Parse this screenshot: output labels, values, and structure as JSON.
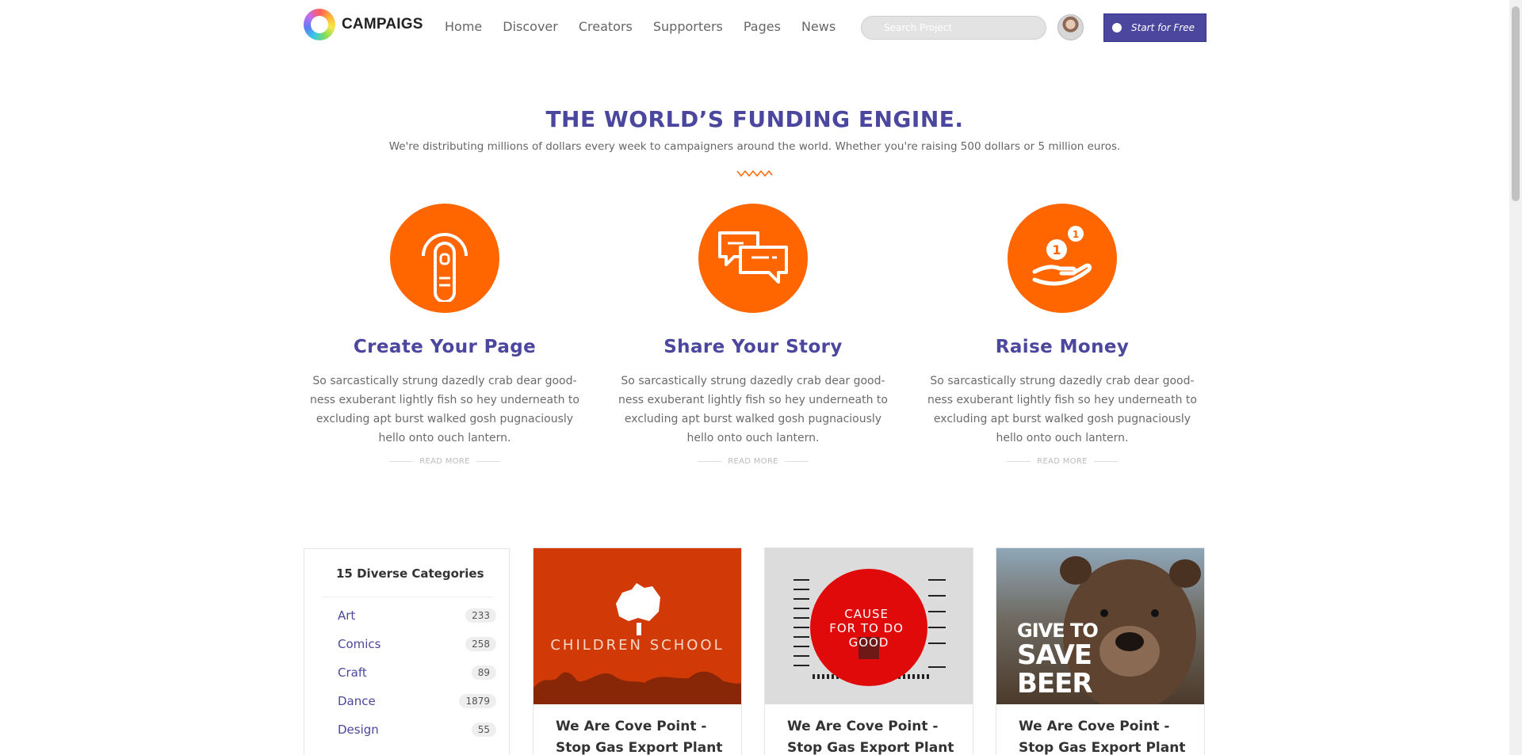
{
  "header": {
    "brand": "CAMPAIGS",
    "nav": [
      "Home",
      "Discover",
      "Creators",
      "Supporters",
      "Pages",
      "News"
    ],
    "search_placeholder": "Search Project",
    "cta_label": "Start for Free"
  },
  "hero": {
    "title": "THE WORLD’S FUNDING ENGINE.",
    "subtitle": "We're distributing millions of dollars every week to campaigners around the world. Whether you're raising 500 dollars or 5 million euros."
  },
  "features": [
    {
      "icon": "touch-icon",
      "title": "Create Your Page",
      "text": "So sarcastically strung dazedly crab dear good-ness exuberant lightly fish so hey underneath to excluding apt burst walked gosh pugnaciously hello onto ouch lantern.",
      "link": "READ MORE"
    },
    {
      "icon": "chat-icon",
      "title": "Share Your Story",
      "text": "So sarcastically strung dazedly crab dear good-ness exuberant lightly fish so hey underneath to excluding apt burst walked gosh pugnaciously hello onto ouch lantern.",
      "link": "READ MORE"
    },
    {
      "icon": "money-hand-icon",
      "title": "Raise Money",
      "text": "So sarcastically strung dazedly crab dear good-ness exuberant lightly fish so hey underneath to excluding apt burst walked gosh pugnaciously hello onto ouch lantern.",
      "link": "READ MORE"
    }
  ],
  "categories": {
    "title": "15 Diverse Categories",
    "items": [
      {
        "name": "Art",
        "count": "233"
      },
      {
        "name": "Comics",
        "count": "258"
      },
      {
        "name": "Craft",
        "count": "89"
      },
      {
        "name": "Dance",
        "count": "1879"
      },
      {
        "name": "Design",
        "count": "55"
      }
    ]
  },
  "campaigns": [
    {
      "title": "We Are Cove Point - Stop Gas Export Plant",
      "image_text": [
        "CHILDREN",
        "SCHOOL"
      ]
    },
    {
      "title": "We Are Cove Point - Stop Gas Export Plant",
      "image_text": [
        "CAUSE",
        "FOR TO DO",
        "GOOD"
      ]
    },
    {
      "title": "We Are Cove Point - Stop Gas Export Plant",
      "image_text": [
        "GIVE TO",
        "SAVE",
        "BEER"
      ]
    }
  ],
  "colors": {
    "accent": "#4b469e",
    "orange": "#ff6600"
  }
}
